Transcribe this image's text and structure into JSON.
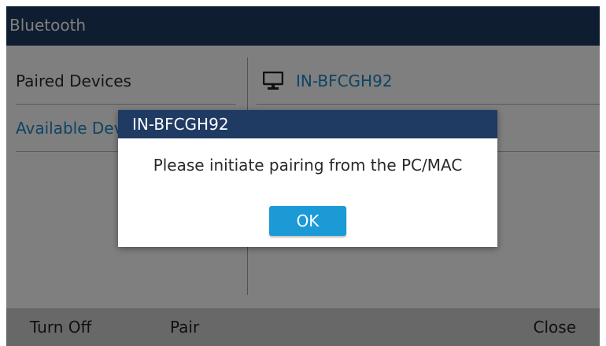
{
  "header": {
    "title": "Bluetooth"
  },
  "menu": {
    "paired_devices": "Paired Devices",
    "available_devices": "Available Devices"
  },
  "devices": [
    {
      "name": "IN-BFCGH92",
      "icon": "computer-icon"
    }
  ],
  "dialog": {
    "title": "IN-BFCGH92",
    "message": "Please initiate pairing from the PC/MAC",
    "ok_label": "OK"
  },
  "softkeys": {
    "turn_off": "Turn Off",
    "pair": "Pair",
    "close": "Close"
  },
  "colors": {
    "titlebar": "#1f3a63",
    "accent": "#1c86c8",
    "ok_button": "#1c9ad6",
    "softkey_bar": "#d0d0d0"
  }
}
